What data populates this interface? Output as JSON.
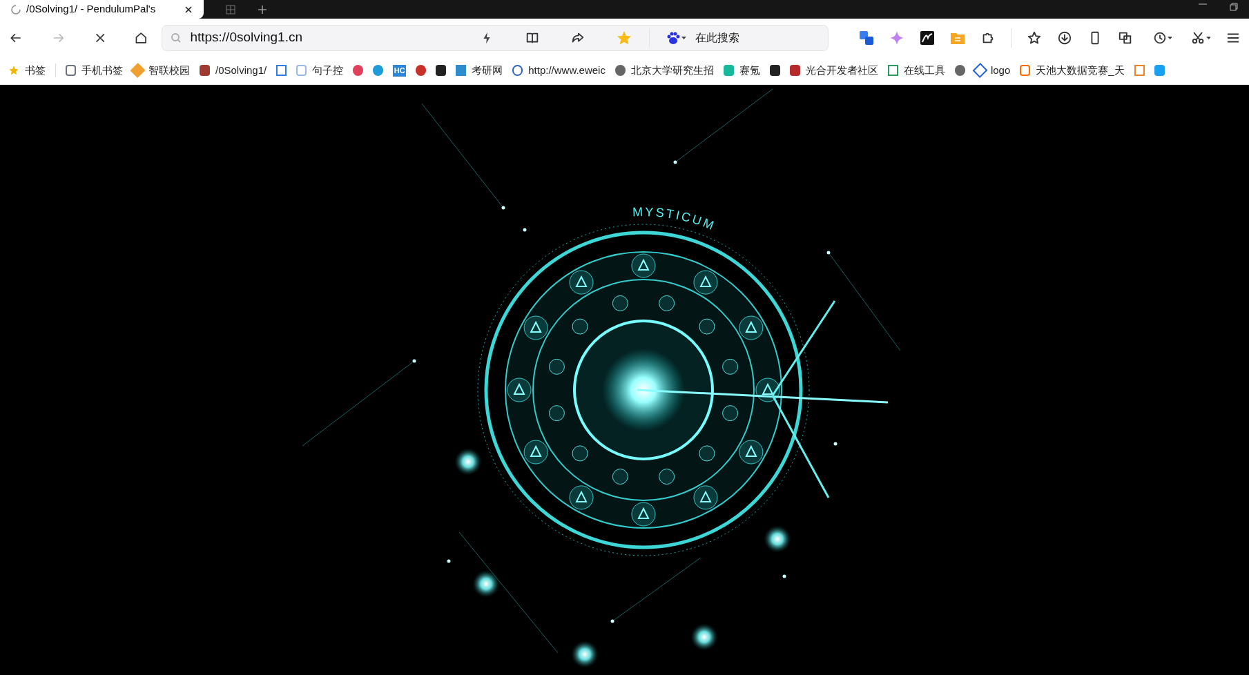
{
  "tabs": [
    {
      "title": "/0Solving1/ - PendulumPal's",
      "loading": true,
      "selected": true
    }
  ],
  "toolbar": {
    "forward_disabled": true,
    "loading": true,
    "address": "https://0solving1.cn",
    "bookmarked": true,
    "search_placeholder": "在此搜索"
  },
  "bookmarks": [
    {
      "kind": "link",
      "label": "书签"
    },
    {
      "kind": "divider"
    },
    {
      "kind": "link",
      "label": "手机书签"
    },
    {
      "kind": "link",
      "label": "智联校园"
    },
    {
      "kind": "link",
      "label": "/0Solving1/"
    },
    {
      "kind": "icon"
    },
    {
      "kind": "link",
      "label": "句子控"
    },
    {
      "kind": "icon"
    },
    {
      "kind": "icon"
    },
    {
      "kind": "icon",
      "badge": "HC"
    },
    {
      "kind": "icon"
    },
    {
      "kind": "icon"
    },
    {
      "kind": "link",
      "label": "考研网"
    },
    {
      "kind": "link",
      "label": "http://www.eweic"
    },
    {
      "kind": "link",
      "label": "北京大学研究生招"
    },
    {
      "kind": "link",
      "label": "赛氪"
    },
    {
      "kind": "icon"
    },
    {
      "kind": "link",
      "label": "光合开发者社区"
    },
    {
      "kind": "link",
      "label": "在线工具"
    },
    {
      "kind": "icon"
    },
    {
      "kind": "link",
      "label": "logo"
    },
    {
      "kind": "link",
      "label": "天池大数据竞赛_天"
    },
    {
      "kind": "icon"
    },
    {
      "kind": "icon"
    }
  ],
  "artwork": {
    "caption": "MYSTICUM"
  }
}
